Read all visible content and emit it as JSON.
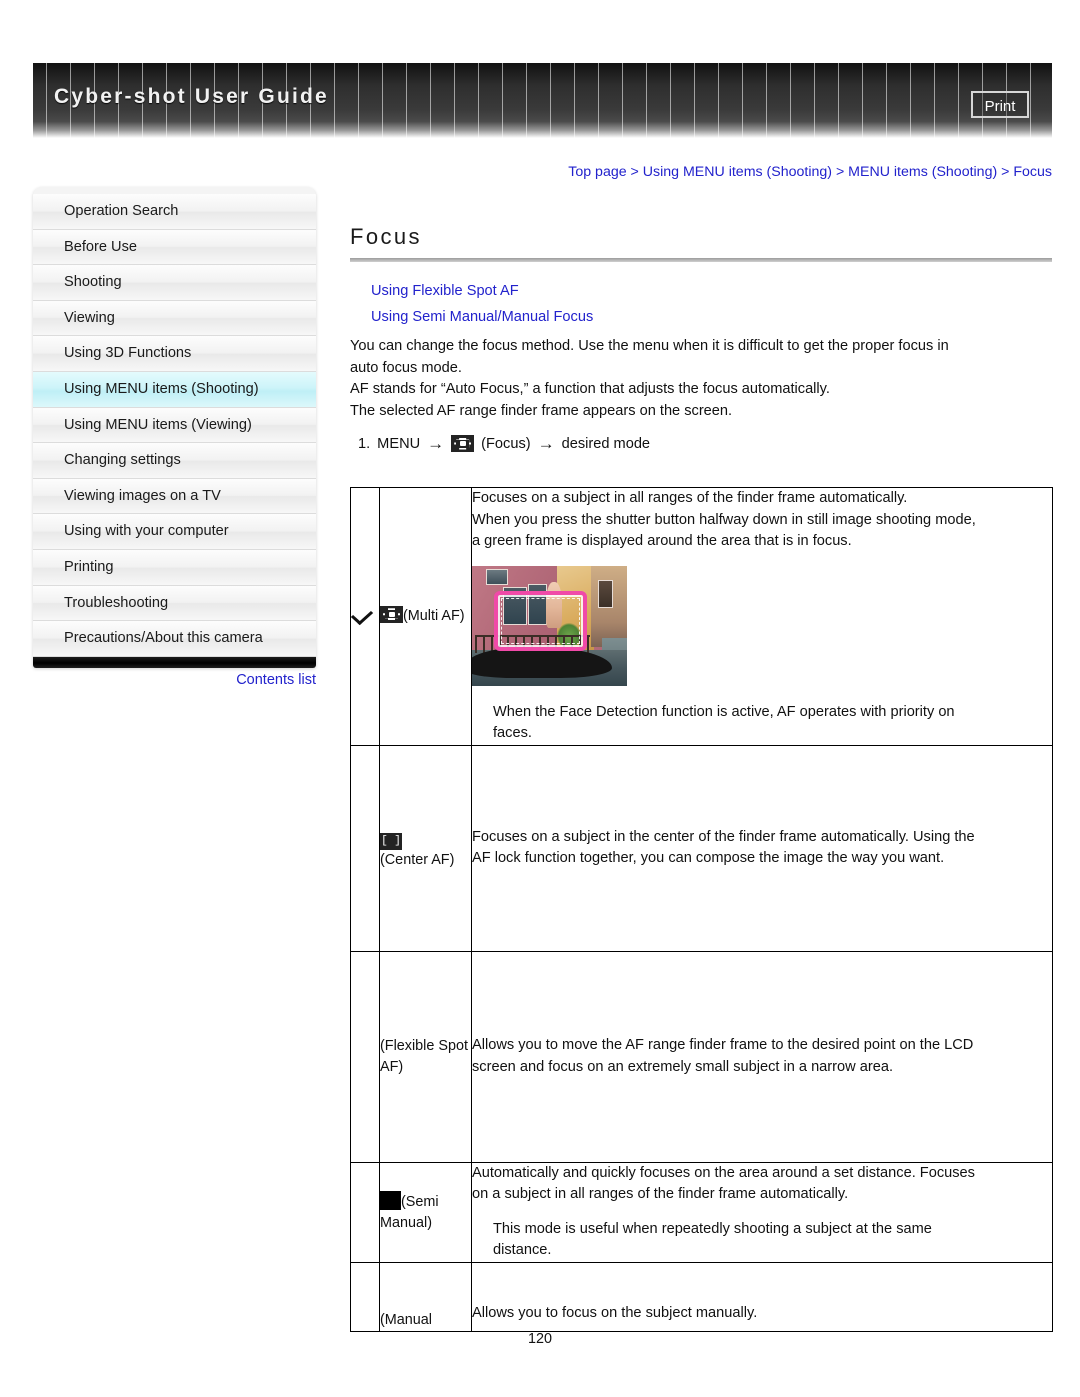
{
  "header": {
    "title": "Cyber-shot User Guide",
    "print_label": "Print"
  },
  "breadcrumb": {
    "text": "Top page > Using MENU items (Shooting) > MENU items (Shooting) > Focus"
  },
  "sidebar": {
    "items": [
      {
        "label": "Operation Search",
        "selected": false
      },
      {
        "label": "Before Use",
        "selected": false
      },
      {
        "label": "Shooting",
        "selected": false
      },
      {
        "label": "Viewing",
        "selected": false
      },
      {
        "label": "Using 3D Functions",
        "selected": false
      },
      {
        "label": "Using MENU items (Shooting)",
        "selected": true
      },
      {
        "label": "Using MENU items (Viewing)",
        "selected": false
      },
      {
        "label": "Changing settings",
        "selected": false
      },
      {
        "label": "Viewing images on a TV",
        "selected": false
      },
      {
        "label": "Using with your computer",
        "selected": false
      },
      {
        "label": "Printing",
        "selected": false
      },
      {
        "label": "Troubleshooting",
        "selected": false
      },
      {
        "label": "Precautions/About this camera",
        "selected": false
      }
    ],
    "contents_list_label": "Contents list"
  },
  "main": {
    "page_title": "Focus",
    "anchors": [
      "Using Flexible Spot AF",
      "Using Semi Manual/Manual Focus"
    ],
    "intro": [
      "You can change the focus method. Use the menu when it is difficult to get the proper focus in",
      "auto focus mode.",
      "AF stands for “Auto Focus,” a function that adjusts the focus automatically.",
      "The selected AF range finder frame appears on the screen."
    ],
    "step": {
      "number": "1.",
      "menu_label": "MENU",
      "arrow": "→",
      "icon_name": "focus-icon",
      "icon_caption": "(Focus)",
      "arrow2": "→",
      "tail": "desired mode"
    }
  },
  "table": {
    "rows": [
      {
        "checked": true,
        "check_glyph": "✓",
        "icon_name": "multi-af-icon",
        "mode_label": "(Multi AF)",
        "desc_lines": [
          "Focuses on a subject in all ranges of the finder frame automatically.",
          "When you press the shutter button halfway down in still image shooting mode,",
          "a green frame is displayed around the area that is in focus."
        ],
        "has_photo": true,
        "photo_alt": "Venice canal scene with gondola and pink AF range finder frame",
        "note_lines": [
          "When the Face Detection function is active, AF operates with priority on",
          "faces."
        ]
      },
      {
        "checked": false,
        "icon_name": "center-af-icon",
        "icon_glyph": "[ ]",
        "mode_label": "(Center AF)",
        "desc_lines": [
          "Focuses on a subject in the center of the finder frame automatically. Using the",
          "AF lock function together, you can compose the image the way you want."
        ],
        "has_photo": false,
        "note_lines": []
      },
      {
        "checked": false,
        "icon_name": "flexible-spot-af-icon",
        "mode_label": "(Flexible Spot AF)",
        "desc_lines": [
          "Allows you to move the AF range finder frame to the desired point on the LCD",
          "screen and focus on an extremely small subject in a narrow area."
        ],
        "has_photo": false,
        "note_lines": []
      },
      {
        "checked": false,
        "icon_name": "semi-manual-icon",
        "mode_label": "(Semi Manual)",
        "desc_lines": [
          "Automatically and quickly focuses on the area around a set distance. Focuses",
          "on a subject in all ranges of the finder frame automatically."
        ],
        "has_photo": false,
        "note_lines": [
          "This mode is useful when repeatedly shooting a subject at the same",
          "distance."
        ]
      },
      {
        "checked": false,
        "icon_name": "manual-icon",
        "mode_label": "(Manual",
        "desc_lines": [
          "Allows you to focus on the subject manually."
        ],
        "has_photo": false,
        "note_lines": []
      }
    ]
  },
  "footer": {
    "page_number": "120"
  },
  "colors": {
    "link": "#2222cc",
    "selected_nav": "#cdf4f9",
    "af_frame": "#f04aa8",
    "header_dark": "#2e2e2e"
  }
}
